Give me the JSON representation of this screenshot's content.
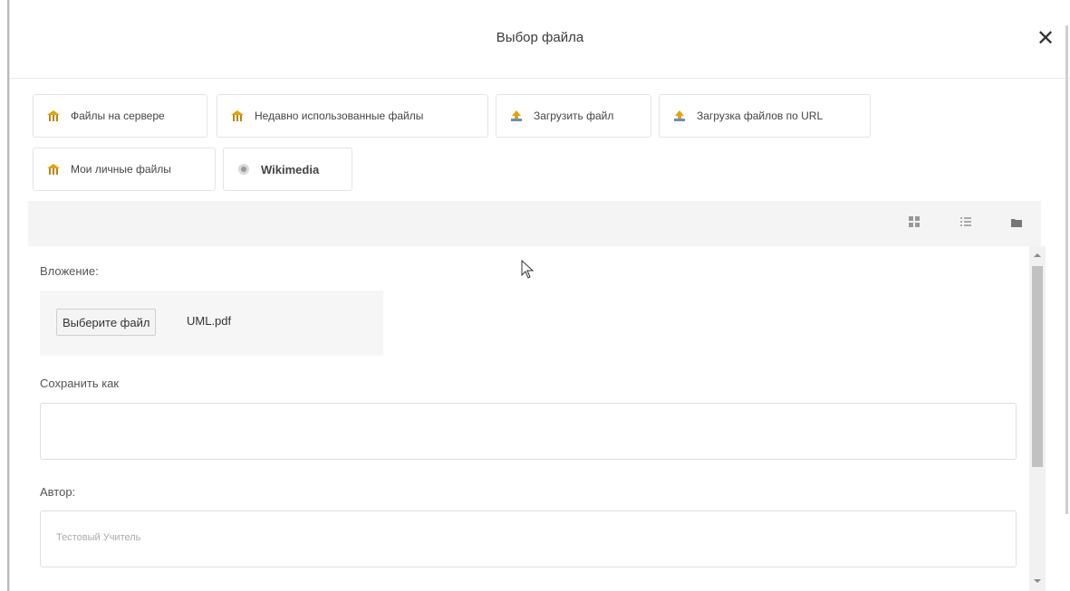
{
  "dialog": {
    "title": "Выбор файла",
    "close_label": "✕"
  },
  "repositories": [
    {
      "label": "Файлы на сервере",
      "icon": "server-files-icon"
    },
    {
      "label": "Недавно использованные файлы",
      "icon": "recent-files-icon"
    },
    {
      "label": "Загрузить файл",
      "icon": "upload-icon"
    },
    {
      "label": "Загрузка файлов по URL",
      "icon": "url-download-icon"
    },
    {
      "label": "Мои личные файлы",
      "icon": "private-files-icon"
    },
    {
      "label": "Wikimedia",
      "icon": "wikimedia-icon"
    }
  ],
  "toolbar": {
    "views": [
      "icons-view-icon",
      "list-view-icon",
      "tree-view-icon"
    ]
  },
  "form": {
    "attachment_label": "Вложение:",
    "choose_file_label": "Выберите файл",
    "file_name": "UML.pdf",
    "save_as_label": "Сохранить как",
    "save_as_value": "",
    "author_label": "Автор:",
    "author_placeholder": "Тестовый Учитель"
  },
  "colors": {
    "accent_icon": "#e8a200",
    "toolbar_bg": "#f4f4f4"
  }
}
